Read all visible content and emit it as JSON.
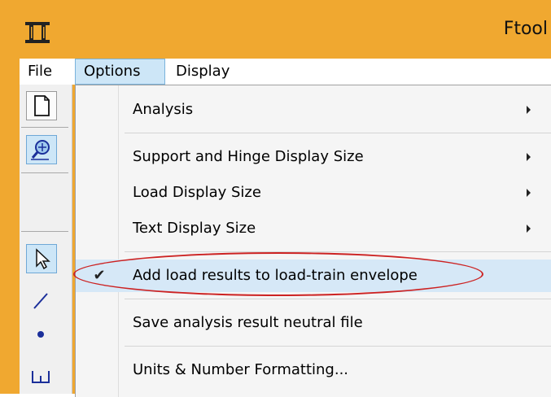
{
  "window": {
    "title": "Ftool",
    "logo_icon": "ftool-logo-icon"
  },
  "menubar": {
    "items": [
      {
        "label": "File"
      },
      {
        "label": "Options"
      },
      {
        "label": "Display"
      }
    ]
  },
  "toolbar": {
    "buttons": [
      {
        "icon": "new-document-icon"
      },
      {
        "icon": "zoom-fit-icon"
      },
      {
        "icon": "select-pointer-icon"
      },
      {
        "icon": "draw-line-icon"
      },
      {
        "icon": "node-icon"
      },
      {
        "icon": "support-icon"
      }
    ]
  },
  "options_menu": {
    "items": [
      {
        "label": "Analysis",
        "submenu": true
      },
      {
        "label": "Support and Hinge Display Size",
        "submenu": true
      },
      {
        "label": "Load Display Size",
        "submenu": true
      },
      {
        "label": "Text Display Size",
        "submenu": true
      },
      {
        "label": "Add load results to load-train envelope",
        "checked": true,
        "check_glyph": "✔"
      },
      {
        "label": "Save analysis result neutral file"
      },
      {
        "label": "Units & Number Formatting..."
      }
    ]
  },
  "colors": {
    "frame": "#f0a830",
    "menu_highlight": "#cde6f7",
    "annotation": "#cc2222"
  }
}
